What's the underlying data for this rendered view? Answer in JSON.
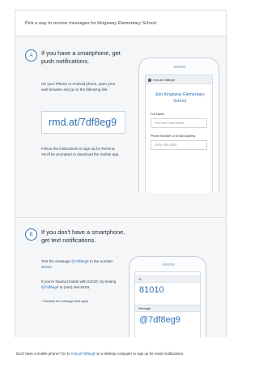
{
  "header": {
    "prompt": "Pick a way to receive messages for Kingsway Elementary School:"
  },
  "option_a": {
    "step": "A",
    "title": "If you have a smartphone, get push notifications.",
    "instructions_1": "On your iPhone or Android phone, open your web browser and go to the following link:",
    "link": "rmd.at/7df8eg9",
    "instructions_2": "Follow the instructions to sign up for Remind. You'll be prompted to download the mobile app.",
    "phone": {
      "url": "rmd.at/7df8eg9",
      "join_title": "Join Kingsway Elementary School",
      "full_name_label": "Full Name",
      "full_name_placeholder": "First and Last Name",
      "phone_email_label": "Phone Number or Email Address",
      "phone_email_placeholder": "(555) 555-5555"
    }
  },
  "option_b": {
    "step": "B",
    "title": "If you don't have a smartphone, get text notifications.",
    "text_prefix": "Text the message",
    "text_code": "@7df8eg9",
    "text_mid": "to the number",
    "text_number": "81010",
    "trouble_prefix": "If you're having trouble with 81010, try texting",
    "trouble_code": "@7df8eg9",
    "trouble_suffix": "to (404) 264-5153.",
    "rates_note": "* Standard text message rates apply.",
    "phone": {
      "to_label": "To",
      "to_value": "81010",
      "message_label": "Message",
      "message_value": "@7df8eg9"
    }
  },
  "footer": {
    "prefix": "Don't have a mobile phone? Go to",
    "link": "rmd.at/7df8eg9",
    "suffix": "on a desktop computer to sign up for email notifications."
  },
  "colors": {
    "accent": "#2f6fb3",
    "panel": "#f4f6f8"
  }
}
